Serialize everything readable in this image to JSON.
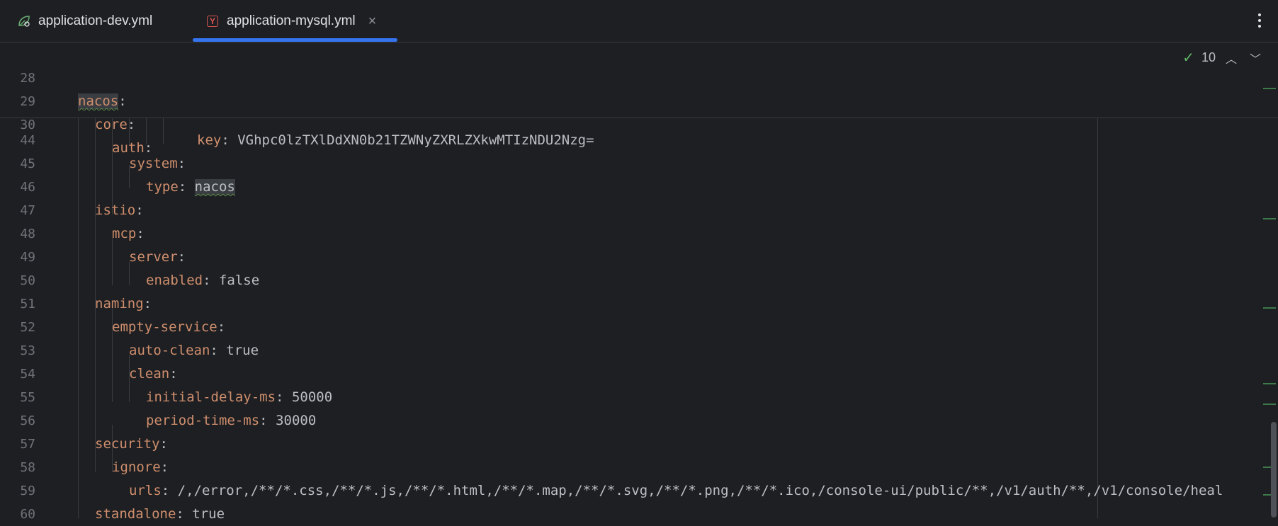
{
  "tabs": [
    {
      "label": "application-dev.yml",
      "icon": "spring-leaf-icon"
    },
    {
      "label": "application-mysql.yml",
      "icon": "yaml-icon",
      "active": true,
      "close": "×"
    }
  ],
  "inspection": {
    "count": "10"
  },
  "sticky_lines": [
    {
      "num": "28",
      "key": "nacos",
      "indent": 0
    },
    {
      "num": "29",
      "key": "core",
      "indent": 1
    },
    {
      "num": "30",
      "key": "auth",
      "indent": 2
    }
  ],
  "lines": [
    {
      "num": "44",
      "key": "key",
      "value": "VGhpc0lzTXlDdXN0b21TZWNyZXRLZXkwMTIzNDU2Nzg=",
      "indent": 7
    },
    {
      "num": "45",
      "key": "system",
      "value": "",
      "indent": 3
    },
    {
      "num": "46",
      "key": "type",
      "value": "nacos",
      "indent": 4
    },
    {
      "num": "47",
      "key": "istio",
      "value": "",
      "indent": 1
    },
    {
      "num": "48",
      "key": "mcp",
      "value": "",
      "indent": 2
    },
    {
      "num": "49",
      "key": "server",
      "value": "",
      "indent": 3
    },
    {
      "num": "50",
      "key": "enabled",
      "value": "false",
      "indent": 4
    },
    {
      "num": "51",
      "key": "naming",
      "value": "",
      "indent": 1
    },
    {
      "num": "52",
      "key": "empty-service",
      "value": "",
      "indent": 2
    },
    {
      "num": "53",
      "key": "auto-clean",
      "value": "true",
      "indent": 3
    },
    {
      "num": "54",
      "key": "clean",
      "value": "",
      "indent": 3
    },
    {
      "num": "55",
      "key": "initial-delay-ms",
      "value": "50000",
      "indent": 4
    },
    {
      "num": "56",
      "key": "period-time-ms",
      "value": "30000",
      "indent": 4
    },
    {
      "num": "57",
      "key": "security",
      "value": "",
      "indent": 1
    },
    {
      "num": "58",
      "key": "ignore",
      "value": "",
      "indent": 2
    },
    {
      "num": "59",
      "key": "urls",
      "value": "/,/error,/**/*.css,/**/*.js,/**/*.html,/**/*.map,/**/*.svg,/**/*.png,/**/*.ico,/console-ui/public/**,/v1/auth/**,/v1/console/heal",
      "indent": 3
    },
    {
      "num": "60",
      "key": "standalone",
      "value": "true",
      "indent": 1
    }
  ],
  "colors": {
    "key": "#cf8e6d",
    "accent": "#3574f0",
    "background": "#1e1f22",
    "ok": "#5fb865"
  }
}
